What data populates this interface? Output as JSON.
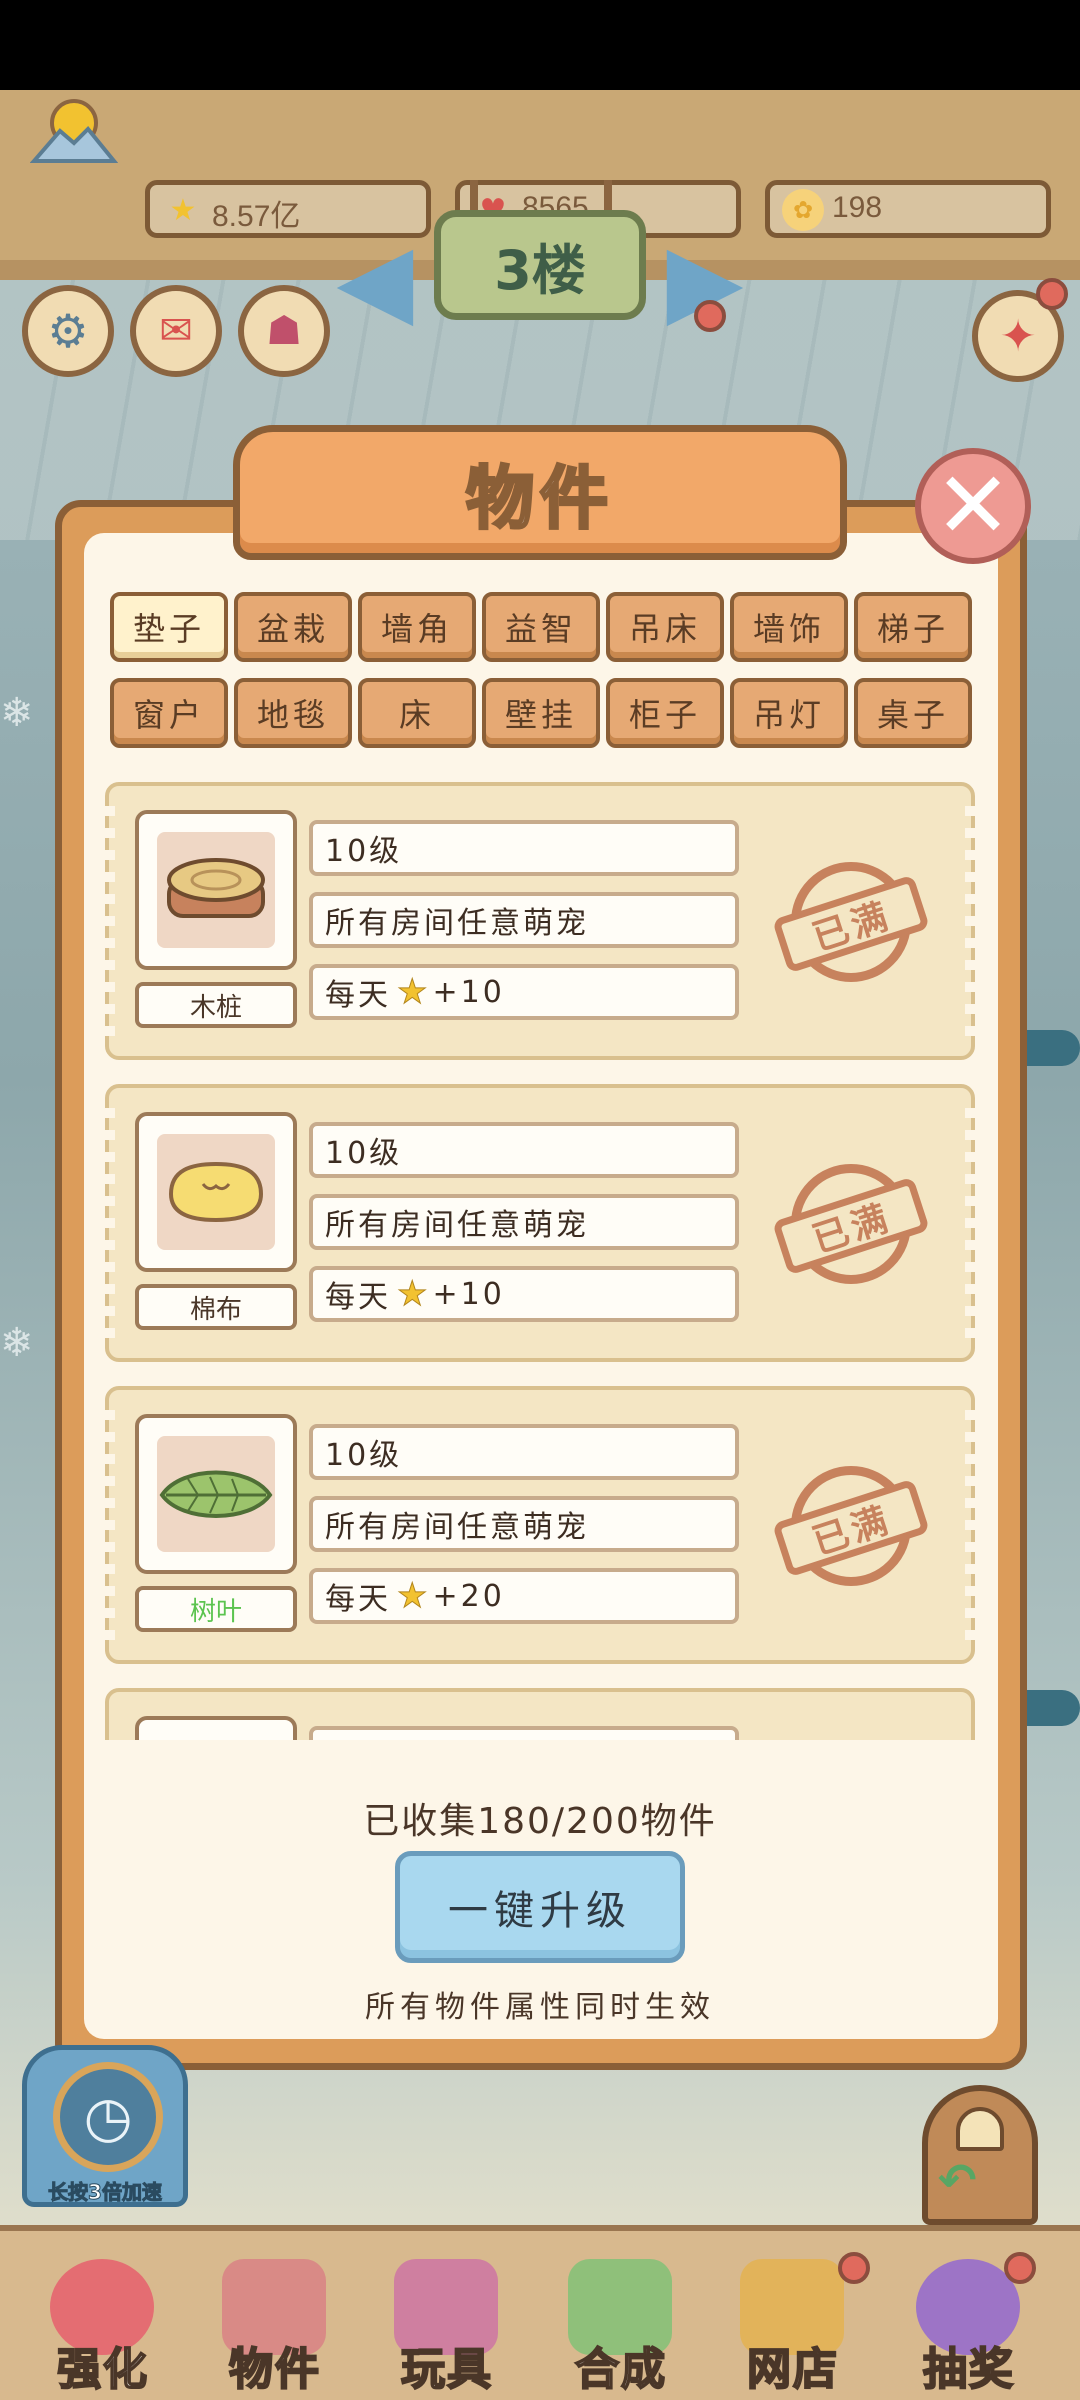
{
  "currencies": [
    {
      "icon": "star-icon",
      "symbol": "★",
      "value": "8.57亿",
      "color": "#f2c230"
    },
    {
      "icon": "heart-icon",
      "symbol": "♥",
      "value": "8565",
      "color": "#d9534f"
    },
    {
      "icon": "paw-coin-icon",
      "symbol": "✿",
      "value": "198",
      "color": "#e4a72f"
    }
  ],
  "floor": {
    "label": "3楼"
  },
  "modal": {
    "title": "物件",
    "close_symbol": "✕",
    "tabs": [
      "垫子",
      "盆栽",
      "墙角",
      "益智",
      "吊床",
      "墙饰",
      "梯子",
      "窗户",
      "地毯",
      "床",
      "壁挂",
      "柜子",
      "吊灯",
      "桌子"
    ],
    "active_tab": "垫子",
    "items": [
      {
        "name": "木桩",
        "level": "10级",
        "scope": "所有房间任意萌宠",
        "reward_prefix": "每天",
        "reward_value": "+10",
        "status": "已满",
        "name_color": "#4a3628",
        "art": "stump"
      },
      {
        "name": "棉布",
        "level": "10级",
        "scope": "所有房间任意萌宠",
        "reward_prefix": "每天",
        "reward_value": "+10",
        "status": "已满",
        "name_color": "#4a3628",
        "art": "cushion"
      },
      {
        "name": "树叶",
        "level": "10级",
        "scope": "所有房间任意萌宠",
        "reward_prefix": "每天",
        "reward_value": "+20",
        "status": "已满",
        "name_color": "#5cc44f",
        "art": "leaf"
      }
    ],
    "collected_text": "已收集180/200物件",
    "upgrade_label": "一键升级",
    "hint": "所有物件属性同时生效"
  },
  "speed_label": "长按3倍加速",
  "bottom_nav": [
    {
      "label": "强化",
      "icon": "swirl-candy-icon",
      "color": "#e46d72"
    },
    {
      "label": "物件",
      "icon": "piano-icon",
      "color": "#d98a86"
    },
    {
      "label": "玩具",
      "icon": "house-toy-icon",
      "color": "#cf7fa0"
    },
    {
      "label": "合成",
      "icon": "cards-icon",
      "color": "#8fc07a"
    },
    {
      "label": "网店",
      "icon": "shop-basket-icon",
      "color": "#e2b35a"
    },
    {
      "label": "抽奖",
      "icon": "lottery-wheel-icon",
      "color": "#9d74c6"
    }
  ]
}
